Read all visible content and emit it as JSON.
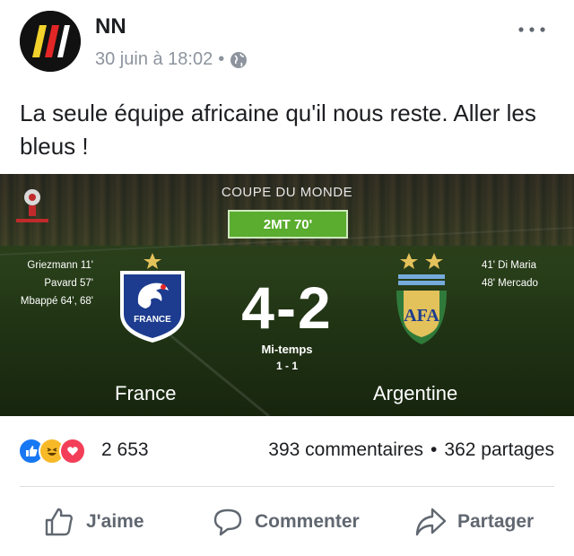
{
  "post": {
    "page_name": "NN",
    "timestamp": "30 juin à 18:02",
    "separator": "•",
    "privacy_icon": "globe-icon",
    "more_icon": "more-icon",
    "text": "La seule équipe africaine qu'il nous reste. Aller les bleus !"
  },
  "match": {
    "competition": "COUPE DU MONDE",
    "time_badge": "2MT 70'",
    "world_cup_logo": "world-cup-logo",
    "score": "4-2",
    "half_time_label": "Mi-temps",
    "half_time_score": "1 - 1",
    "home": {
      "name": "France",
      "crest_text": "FRANCE",
      "scorers": [
        "Griezmann  11'",
        "Pavard  57'",
        "Mbappé  64', 68'"
      ]
    },
    "away": {
      "name": "Argentine",
      "crest_text": "AFA",
      "scorers": [
        "41'  Di Maria",
        "48'  Mercado"
      ]
    },
    "colors": {
      "badge_green": "#5aad2e",
      "france_blue": "#1d3c8f",
      "argentina_sky": "#75aadb",
      "gold": "#e3c15b"
    }
  },
  "engagement": {
    "reaction_icons": [
      "like-icon",
      "haha-icon",
      "love-icon"
    ],
    "reaction_count": "2 653",
    "comments": "393 commentaires",
    "separator": "•",
    "shares": "362 partages"
  },
  "actions": {
    "like": "J'aime",
    "comment": "Commenter",
    "share": "Partager"
  }
}
